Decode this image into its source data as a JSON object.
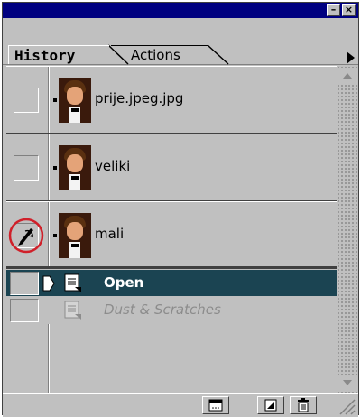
{
  "window": {
    "minimize_label": "–",
    "close_label": "×"
  },
  "tabs": [
    {
      "label": "History",
      "active": true
    },
    {
      "label": "Actions",
      "active": false
    }
  ],
  "snapshots": [
    {
      "label": "prije.jpeg.jpg",
      "history_source": false
    },
    {
      "label": "veliki",
      "history_source": false
    },
    {
      "label": "mali",
      "history_source": true
    }
  ],
  "states": [
    {
      "label": "Open",
      "selected": true,
      "dimmed": false
    },
    {
      "label": "Dust & Scratches",
      "selected": false,
      "dimmed": true
    }
  ],
  "bottom_buttons": [
    {
      "icon": "new-document-from-state-icon"
    },
    {
      "icon": "new-snapshot-icon"
    },
    {
      "icon": "trash-icon"
    }
  ],
  "colors": {
    "panel": "#c0c0c0",
    "title_bar": "#000080",
    "selected_row": "#1b4452",
    "highlight_circle": "#d0202a"
  }
}
